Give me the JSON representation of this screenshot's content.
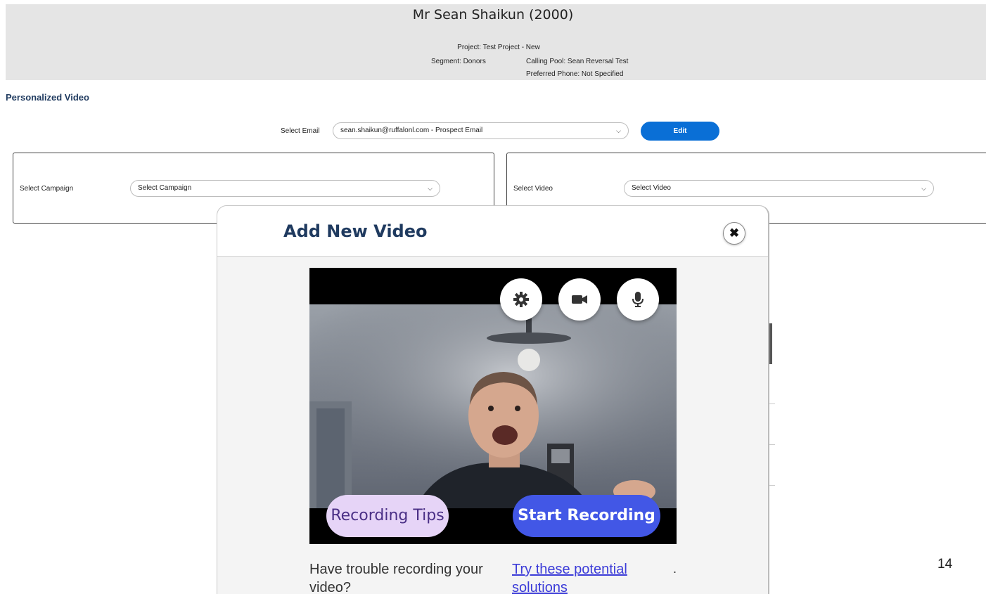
{
  "header": {
    "name": "Mr Sean Shaikun (2000)",
    "project": "Project: Test Project - New",
    "segment": "Segment: Donors",
    "calling_pool": "Calling Pool: Sean Reversal Test",
    "preferred_phone": "Preferred Phone:  Not Specified"
  },
  "section_title": "Personalized Video",
  "email": {
    "label": "Select Email",
    "value": "sean.shaikun@ruffalonl.com - Prospect Email",
    "edit_label": "Edit"
  },
  "campaign": {
    "label": "Select Campaign",
    "value": "Select Campaign"
  },
  "video_select": {
    "label": "Select Video",
    "value": "Select Video"
  },
  "modal": {
    "title": "Add New Video",
    "recording_tips_label": "Recording Tips",
    "start_recording_label": "Start Recording",
    "help_text": "Have trouble recording your video?",
    "help_link": "Try these potential solutions",
    "help_dot": "."
  },
  "page_number": "14",
  "colors": {
    "brand_blue": "#0a6fd6",
    "title_navy": "#1f3a5f",
    "start_button": "#4257e6",
    "tips_button": "#e6d4f7"
  }
}
